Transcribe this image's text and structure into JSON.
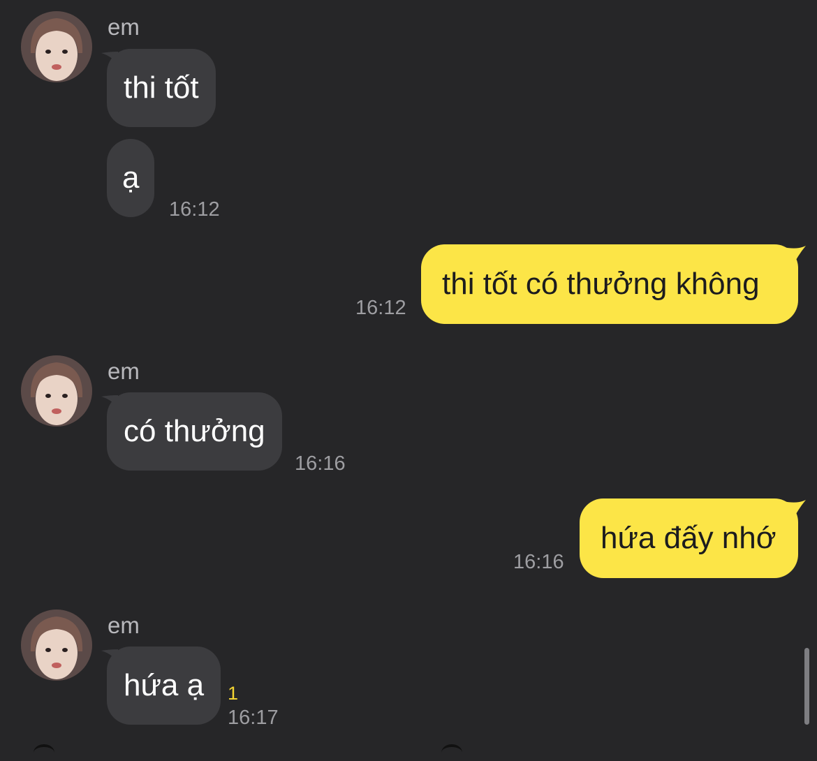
{
  "contact": {
    "name": "em"
  },
  "messages": [
    {
      "sender": "em",
      "direction": "incoming",
      "text": "thi tốt"
    },
    {
      "sender": "em",
      "direction": "incoming",
      "text": "ạ",
      "time": "16:12"
    },
    {
      "direction": "outgoing",
      "text": "thi tốt có thưởng không",
      "time": "16:12"
    },
    {
      "sender": "em",
      "direction": "incoming",
      "text": "có thưởng",
      "time": "16:16"
    },
    {
      "direction": "outgoing",
      "text": "hứa đấy nhớ",
      "time": "16:16"
    },
    {
      "sender": "em",
      "direction": "incoming",
      "text": "hứa ạ",
      "time": "16:17",
      "unread_count": "1"
    }
  ],
  "colors": {
    "background": "#262628",
    "incoming_bubble": "#3c3c3f",
    "outgoing_bubble": "#fce547",
    "unread_indicator": "#f4d532"
  },
  "icons": {
    "avatar": "profile-photo"
  }
}
